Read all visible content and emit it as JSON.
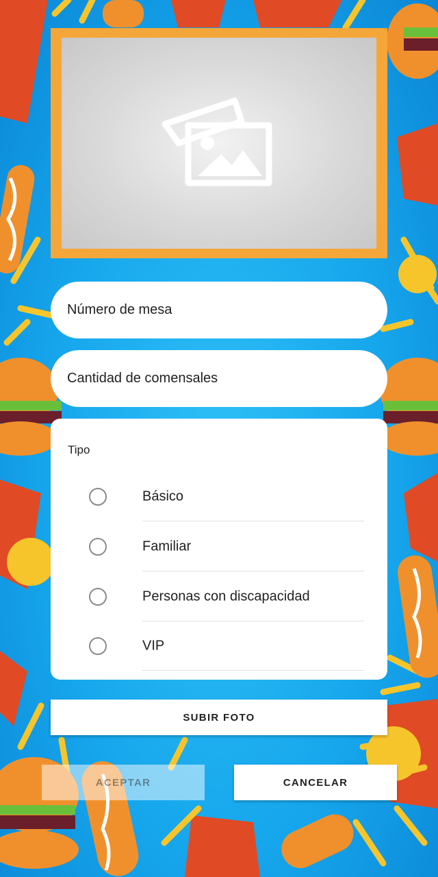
{
  "photo": {
    "icon": "image-placeholder-icon"
  },
  "fields": {
    "mesa_placeholder": "Número de mesa",
    "comensales_placeholder": "Cantidad de comensales"
  },
  "tipo": {
    "label": "Tipo",
    "options": [
      "Básico",
      "Familiar",
      "Personas con discapacidad",
      "VIP"
    ],
    "selected": null
  },
  "buttons": {
    "subir_foto": "SUBIR FOTO",
    "aceptar": "ACEPTAR",
    "cancelar": "CANCELAR"
  },
  "colors": {
    "background": "#16a6ec",
    "frame": "#f5a638",
    "card": "#ffffff"
  }
}
